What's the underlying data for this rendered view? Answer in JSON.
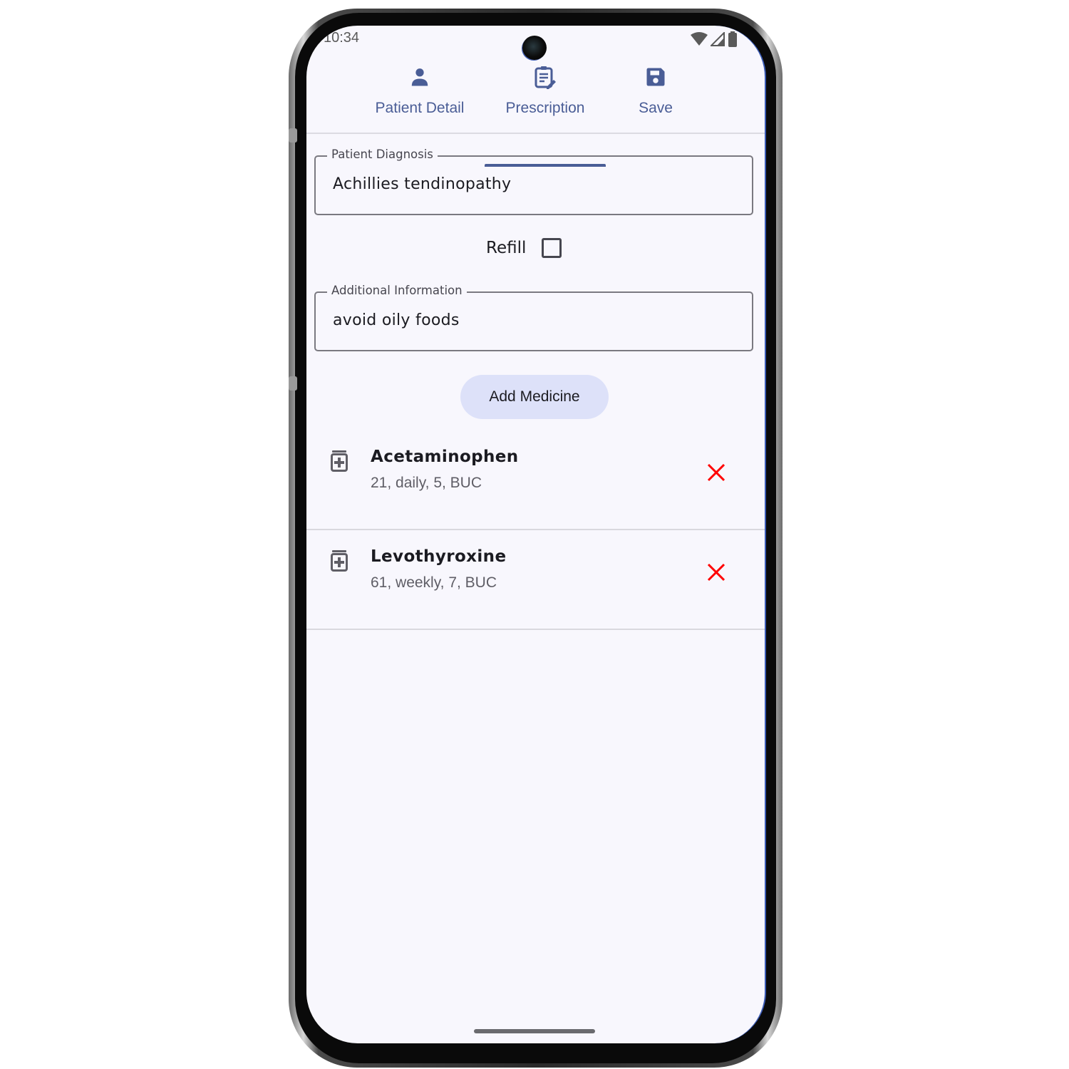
{
  "status_bar": {
    "time": "10:34",
    "icons": [
      "wifi-icon",
      "cellular-signal-icon",
      "battery-icon"
    ]
  },
  "tabs": [
    {
      "label": "Patient Detail",
      "icon": "person-icon",
      "selected": false
    },
    {
      "label": "Prescription",
      "icon": "clipboard-edit-icon",
      "selected": true
    },
    {
      "label": "Save",
      "icon": "floppy-disk-icon",
      "selected": false
    }
  ],
  "form": {
    "diagnosis": {
      "label": "Patient Diagnosis",
      "value": "Achillies tendinopathy"
    },
    "refill": {
      "label": "Refill",
      "checked": false
    },
    "additional_info": {
      "label": "Additional Information",
      "value": "avoid oily foods"
    },
    "add_medicine_label": "Add Medicine"
  },
  "medicines": [
    {
      "name": "Acetaminophen",
      "detail": "21, daily, 5, BUC",
      "icon": "medication-icon"
    },
    {
      "name": "Levothyroxine",
      "detail": "61, weekly, 7, BUC",
      "icon": "medication-icon"
    }
  ],
  "colors": {
    "primary": "#4a5d96",
    "button_container": "#dde1f9",
    "delete": "#ff0000",
    "background": "#f8f7fd"
  }
}
